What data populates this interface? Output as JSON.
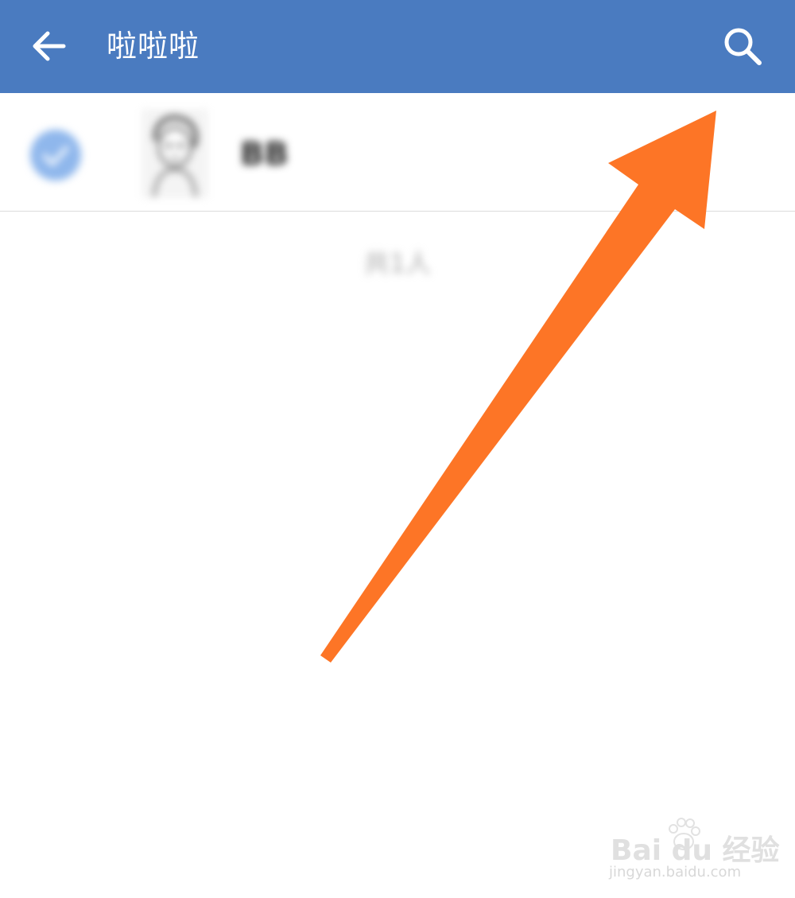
{
  "app_bar": {
    "title": "啦啦啦",
    "background": "#4a7bc0",
    "back_icon": "arrow-left-icon",
    "search_icon": "search-icon"
  },
  "member_list": {
    "items": [
      {
        "name": "BB",
        "selected": true,
        "avatar_icon": "avatar-sketch-icon"
      }
    ],
    "count_text": "共1人"
  },
  "annotation": {
    "arrow_color": "#fd7526",
    "points_to": "search-button"
  },
  "watermark": {
    "logo": "Bai du 经验",
    "url": "jingyan.baidu.com"
  }
}
